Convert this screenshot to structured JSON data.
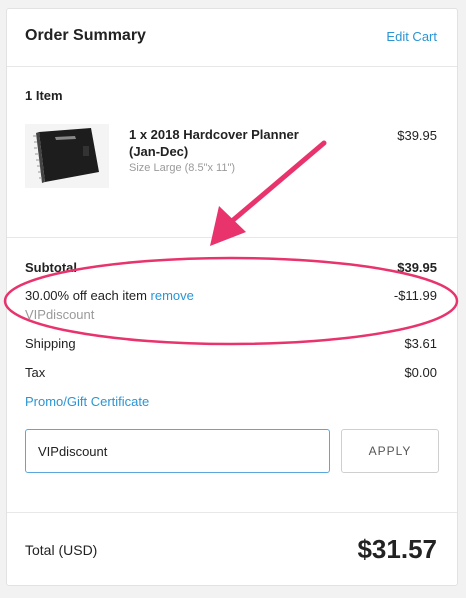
{
  "header": {
    "title": "Order Summary",
    "edit_cart": "Edit Cart"
  },
  "items": {
    "count_label": "1 Item",
    "list": [
      {
        "name": "1 x 2018 Hardcover Planner (Jan-Dec)",
        "size": "Size Large (8.5\"x 11\")",
        "price": "$39.95"
      }
    ]
  },
  "totals": {
    "subtotal_label": "Subtotal",
    "subtotal_value": "$39.95",
    "discount_label": "30.00% off each item",
    "discount_remove": "remove",
    "discount_value": "-$11.99",
    "discount_code": "VIPdiscount",
    "shipping_label": "Shipping",
    "shipping_value": "$3.61",
    "tax_label": "Tax",
    "tax_value": "$0.00"
  },
  "promo": {
    "link_label": "Promo/Gift Certificate",
    "input_value": "VIPdiscount",
    "apply_label": "APPLY"
  },
  "total": {
    "label": "Total (USD)",
    "value": "$31.57"
  },
  "colors": {
    "accent": "#2a95d4",
    "annotation": "#e8336d"
  }
}
